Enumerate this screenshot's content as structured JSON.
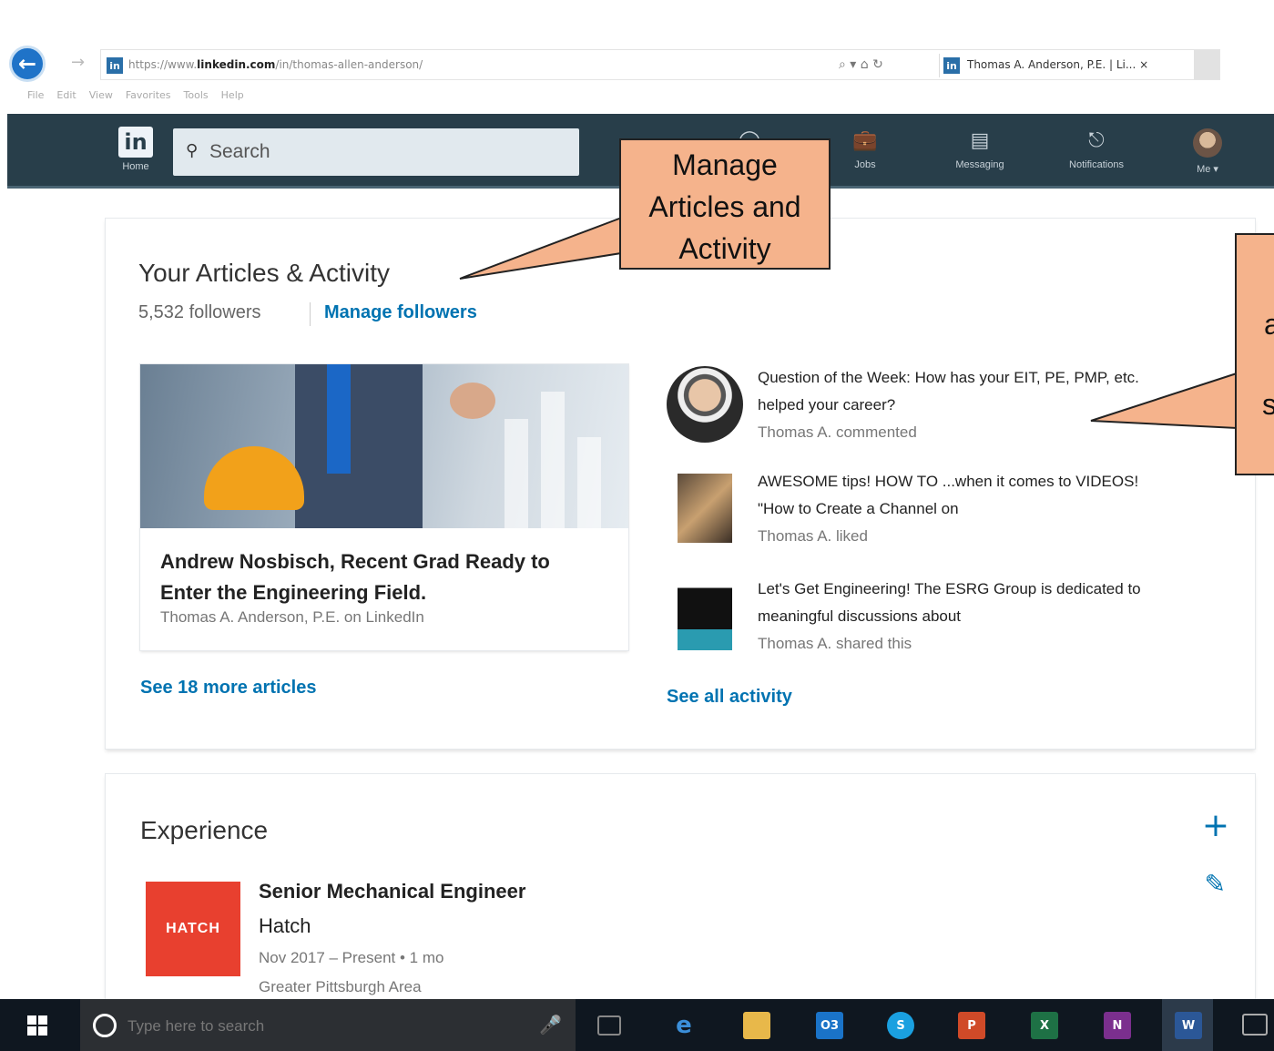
{
  "browser": {
    "url_prefix": "https://www.",
    "url_domain": "linkedin.com",
    "url_path": "/in/thomas-allen-anderson/",
    "tab_title": "Thomas A. Anderson, P.E. | Li... ×",
    "favicon": "in",
    "address_tools": "⌕ ▾ ⌂ ↻",
    "menu": [
      "File",
      "Edit",
      "View",
      "Favorites",
      "Tools",
      "Help"
    ]
  },
  "nav": {
    "home_label": "Home",
    "logo": "in",
    "search_placeholder": "Search",
    "jobs_label": "Jobs",
    "messaging_label": "Messaging",
    "notifications_label": "Notifications",
    "me_label": "Me ▾"
  },
  "articles": {
    "title": "Your Articles & Activity",
    "followers": "5,532 followers",
    "manage_followers": "Manage followers",
    "featured": {
      "title": "Andrew Nosbisch, Recent Grad Ready to Enter the Engineering Field.",
      "meta": "Thomas A. Anderson, P.E. on LinkedIn"
    },
    "see_more": "See 18 more articles",
    "activity": [
      {
        "text": "Question of the Week: How has your EIT, PE, PMP, etc. helped your career?",
        "sub": "Thomas A. commented"
      },
      {
        "text": "AWESOME tips! HOW TO ...when it comes to VIDEOS! \"How to Create a Channel on",
        "sub": "Thomas A. liked"
      },
      {
        "text": "Let's Get Engineering! The ESRG Group is dedicated to meaningful discussions about",
        "sub": "Thomas A. shared this"
      }
    ],
    "see_all": "See all activity"
  },
  "experience": {
    "title": "Experience",
    "add_icon": "+",
    "edit_icon": "✎",
    "job": {
      "logo_text": "HATCH",
      "title": "Senior Mechanical Engineer",
      "company": "Hatch",
      "dates": "Nov 2017 – Present  • 1 mo",
      "location": "Greater Pittsburgh Area"
    }
  },
  "callouts": {
    "manage": [
      "Manage",
      "Articles and",
      "Activity"
    ],
    "right_fragments": [
      "a",
      "s"
    ]
  },
  "taskbar": {
    "search_placeholder": "Type here to search",
    "apps": [
      "e",
      "O3",
      "S",
      "P",
      "X",
      "N",
      "W"
    ]
  },
  "colors": {
    "nav_bg": "#283e4a",
    "link": "#0073b1",
    "callout_fill": "#f5b38c",
    "hatch_red": "#e8402f"
  }
}
